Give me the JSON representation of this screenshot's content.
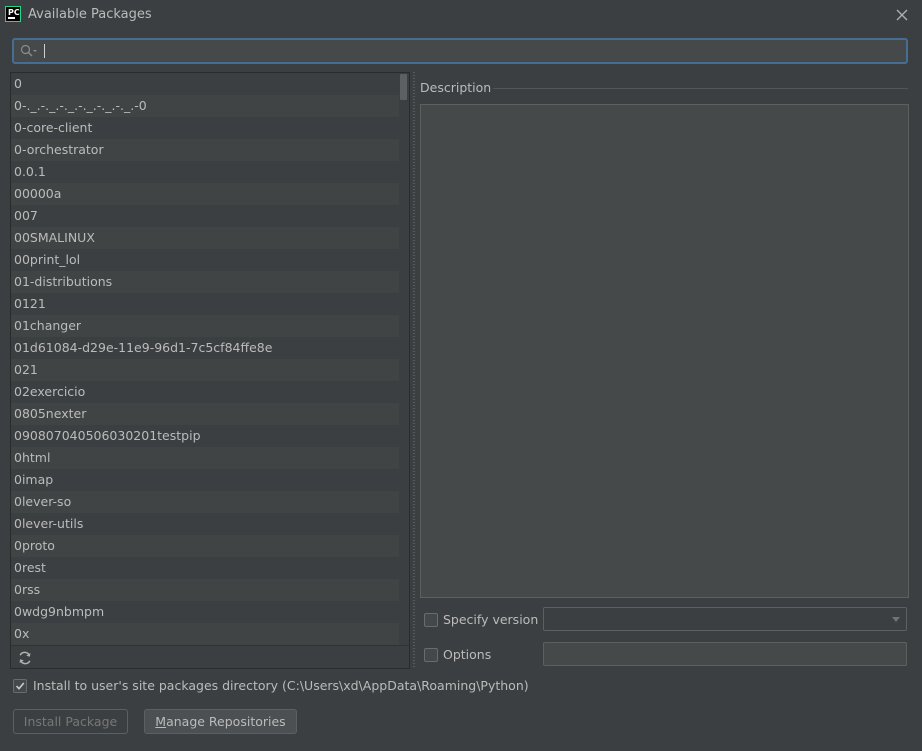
{
  "window": {
    "title": "Available Packages",
    "app_icon_text": "PC"
  },
  "search": {
    "value": "",
    "placeholder": ""
  },
  "packages": [
    "0",
    "0-._.-._.-._.-._.-._.-._.-0",
    "0-core-client",
    "0-orchestrator",
    "0.0.1",
    "00000a",
    "007",
    "00SMALINUX",
    "00print_lol",
    "01-distributions",
    "0121",
    "01changer",
    "01d61084-d29e-11e9-96d1-7c5cf84ffe8e",
    "021",
    "02exercicio",
    "0805nexter",
    "090807040506030201testpip",
    "0html",
    "0imap",
    "0lever-so",
    "0lever-utils",
    "0proto",
    "0rest",
    "0rss",
    "0wdg9nbmpm",
    "0x"
  ],
  "description": {
    "label": "Description",
    "text": ""
  },
  "options": {
    "specify_version_label": "Specify version",
    "specify_version_checked": false,
    "version_value": "",
    "options_label": "Options",
    "options_checked": false,
    "options_value": "",
    "install_user_label": "Install to user's site packages directory (C:\\Users\\xd\\AppData\\Roaming\\Python)",
    "install_user_checked": true
  },
  "buttons": {
    "install_label": "Install Package",
    "manage_mnemonic": "M",
    "manage_rest": "anage Repositories"
  },
  "colors": {
    "accent_border": "#466d94",
    "background": "#3c3f41",
    "text": "#bbbbbb"
  },
  "icons": {
    "close": "close-icon",
    "search": "search-icon",
    "refresh": "refresh-icon",
    "check": "check-icon"
  }
}
